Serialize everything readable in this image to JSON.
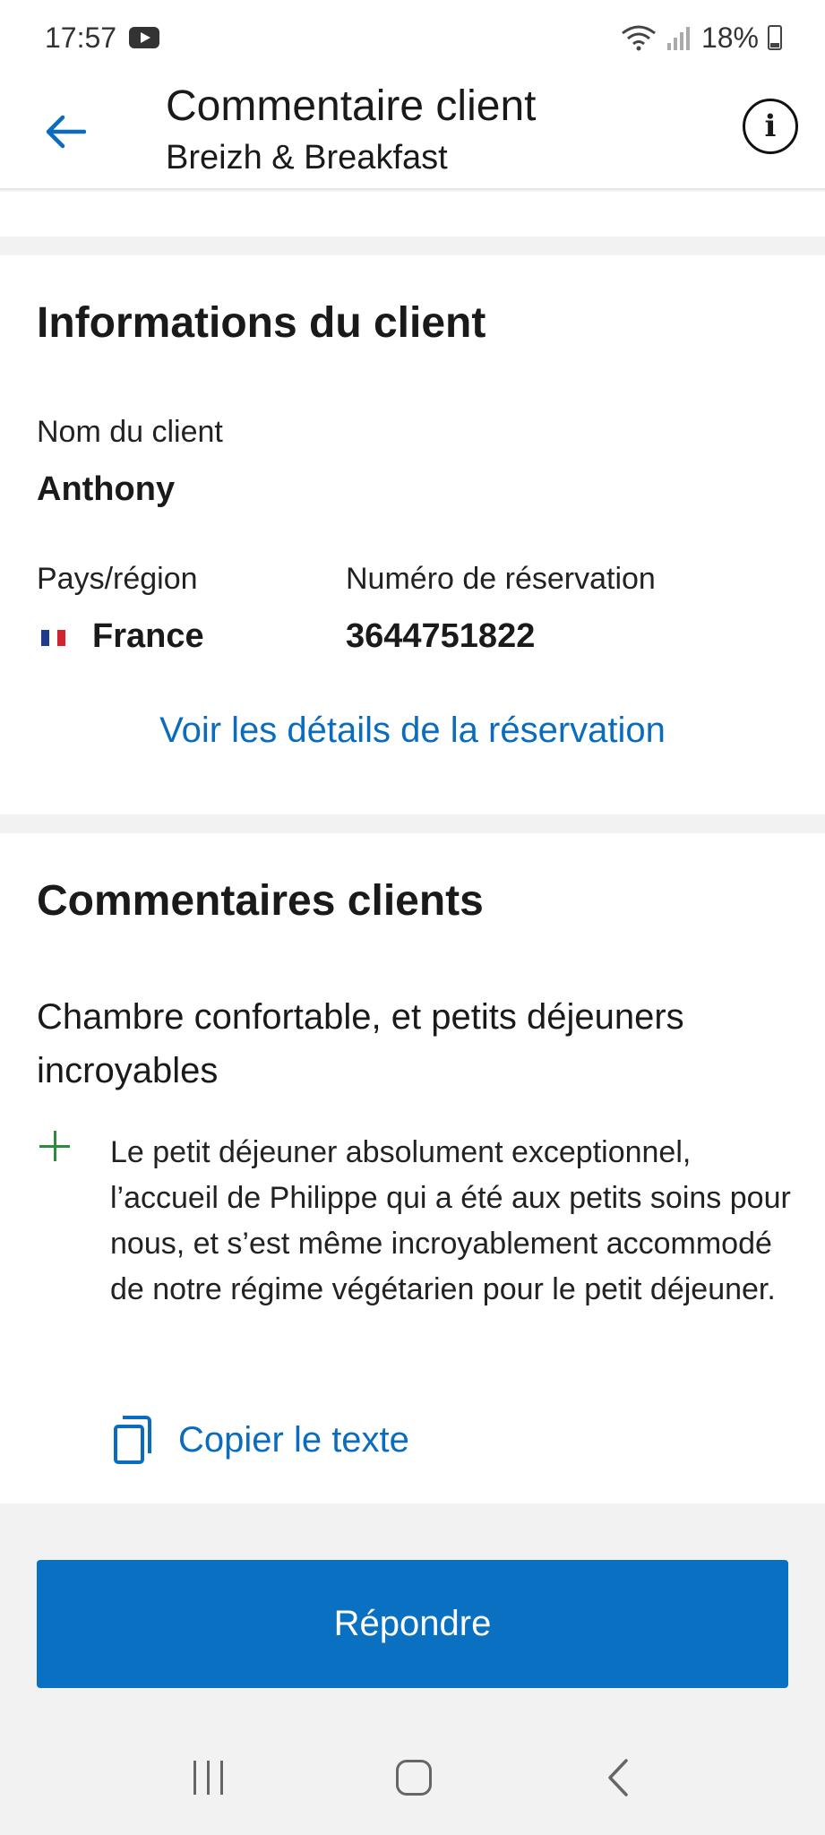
{
  "status_bar": {
    "time": "17:57",
    "battery": "18%",
    "icons": [
      "youtube-icon",
      "wifi-icon",
      "signal-icon",
      "battery-icon"
    ]
  },
  "header": {
    "title": "Commentaire client",
    "subtitle": "Breizh & Breakfast",
    "back_icon": "arrow-left-icon",
    "info_icon": "info-icon",
    "info_glyph": "i"
  },
  "client_info": {
    "section_title": "Informations du client",
    "name_label": "Nom du client",
    "name_value": "Anthony",
    "country_label": "Pays/région",
    "country_value": "France",
    "booking_label": "Numéro de réservation",
    "booking_value": "3644751822",
    "details_link": "Voir les détails de la réservation"
  },
  "reviews": {
    "section_title": "Commentaires clients",
    "review_title": "Chambre confortable, et petits déjeuners incroyables",
    "positive_text": "Le petit déjeuner absolument exceptionnel, l’accueil de Philippe qui a été aux petits soins pour nous, et s’est même incroyablement accommodé de notre régime végétarien pour le petit déjeuner.",
    "copy_label": "Copier le texte"
  },
  "actions": {
    "reply_label": "Répondre"
  },
  "colors": {
    "accent": "#0a6cbf",
    "button": "#0a70c2",
    "positive": "#2e8b3e",
    "background": "#f2f2f2"
  }
}
